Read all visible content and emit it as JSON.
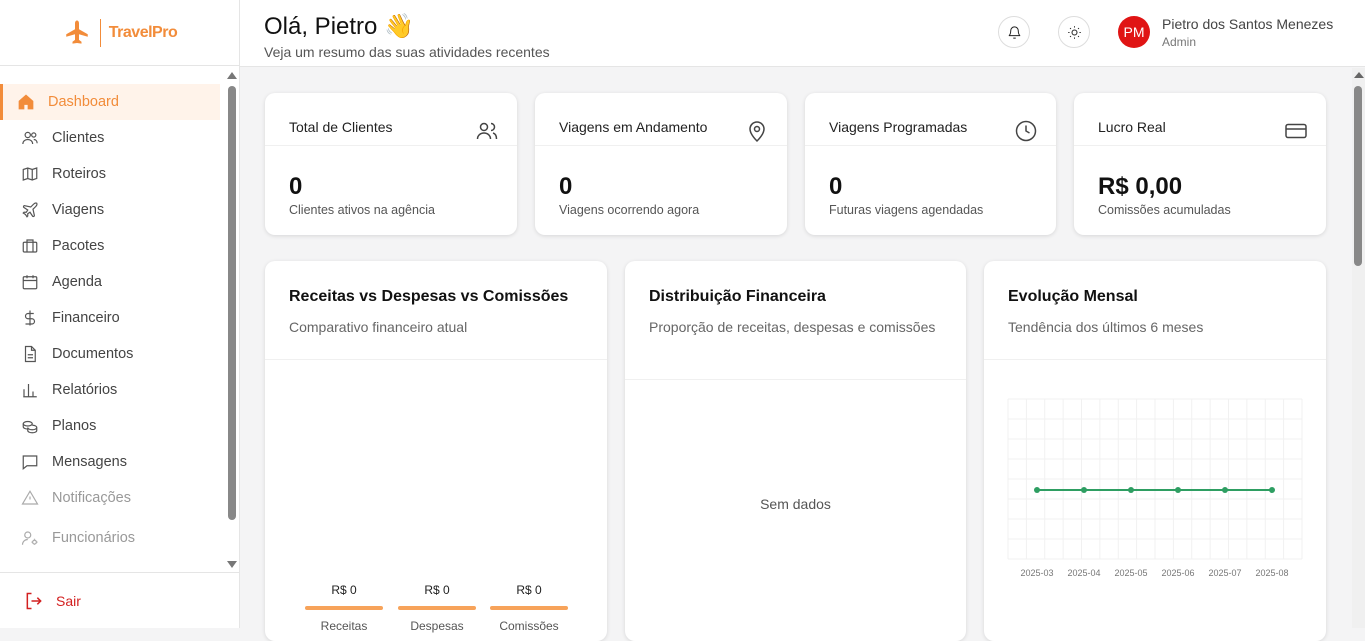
{
  "brand": {
    "name": "TravelPro",
    "color": "#f28c3a"
  },
  "sidebar": {
    "items": [
      {
        "label": "Dashboard",
        "icon": "home-icon",
        "active": true
      },
      {
        "label": "Clientes",
        "icon": "users-icon"
      },
      {
        "label": "Roteiros",
        "icon": "map-icon"
      },
      {
        "label": "Viagens",
        "icon": "plane-icon"
      },
      {
        "label": "Pacotes",
        "icon": "luggage-icon"
      },
      {
        "label": "Agenda",
        "icon": "calendar-icon"
      },
      {
        "label": "Financeiro",
        "icon": "dollar-icon"
      },
      {
        "label": "Documentos",
        "icon": "document-icon"
      },
      {
        "label": "Relatórios",
        "icon": "bar-chart-icon"
      },
      {
        "label": "Planos",
        "icon": "coins-icon"
      },
      {
        "label": "Mensagens",
        "icon": "message-icon"
      },
      {
        "label": "Notificações",
        "icon": "alert-icon",
        "muted": true
      },
      {
        "label": "Funcionários",
        "icon": "user-cog-icon",
        "muted": true
      }
    ],
    "logout_label": "Sair"
  },
  "header": {
    "greeting": "Olá, Pietro 👋",
    "subtitle": "Veja um resumo das suas atividades recentes",
    "user_initials": "PM",
    "user_name": "Pietro dos Santos Menezes",
    "user_role": "Admin"
  },
  "stats": [
    {
      "title": "Total de Clientes",
      "value": "0",
      "sub": "Clientes ativos na agência",
      "icon": "users-icon"
    },
    {
      "title": "Viagens em Andamento",
      "value": "0",
      "sub": "Viagens ocorrendo agora",
      "icon": "map-pin-icon"
    },
    {
      "title": "Viagens Programadas",
      "value": "0",
      "sub": "Futuras viagens agendadas",
      "icon": "clock-icon"
    },
    {
      "title": "Lucro Real",
      "value": "R$ 0,00",
      "sub": "Comissões acumuladas",
      "icon": "credit-card-icon"
    }
  ],
  "panels": {
    "revenue": {
      "title": "Receitas vs Despesas vs Comissões",
      "subtitle": "Comparativo financeiro atual"
    },
    "distribution": {
      "title": "Distribuição Financeira",
      "subtitle": "Proporção de receitas, despesas e comissões",
      "empty": "Sem dados"
    },
    "monthly": {
      "title": "Evolução Mensal",
      "subtitle": "Tendência dos últimos 6 meses"
    }
  },
  "chart_data": [
    {
      "type": "bar",
      "categories": [
        "Receitas",
        "Despesas",
        "Comissões"
      ],
      "values": [
        0,
        0,
        0
      ],
      "value_labels": [
        "R$ 0",
        "R$ 0",
        "R$ 0"
      ],
      "color": "#f7a35a"
    },
    {
      "type": "line",
      "x": [
        "2025-03",
        "2025-04",
        "2025-05",
        "2025-06",
        "2025-07",
        "2025-08"
      ],
      "series": [
        {
          "values": [
            0,
            0,
            0,
            0,
            0,
            0
          ]
        }
      ],
      "color": "#2e9e62",
      "grid": true
    }
  ]
}
